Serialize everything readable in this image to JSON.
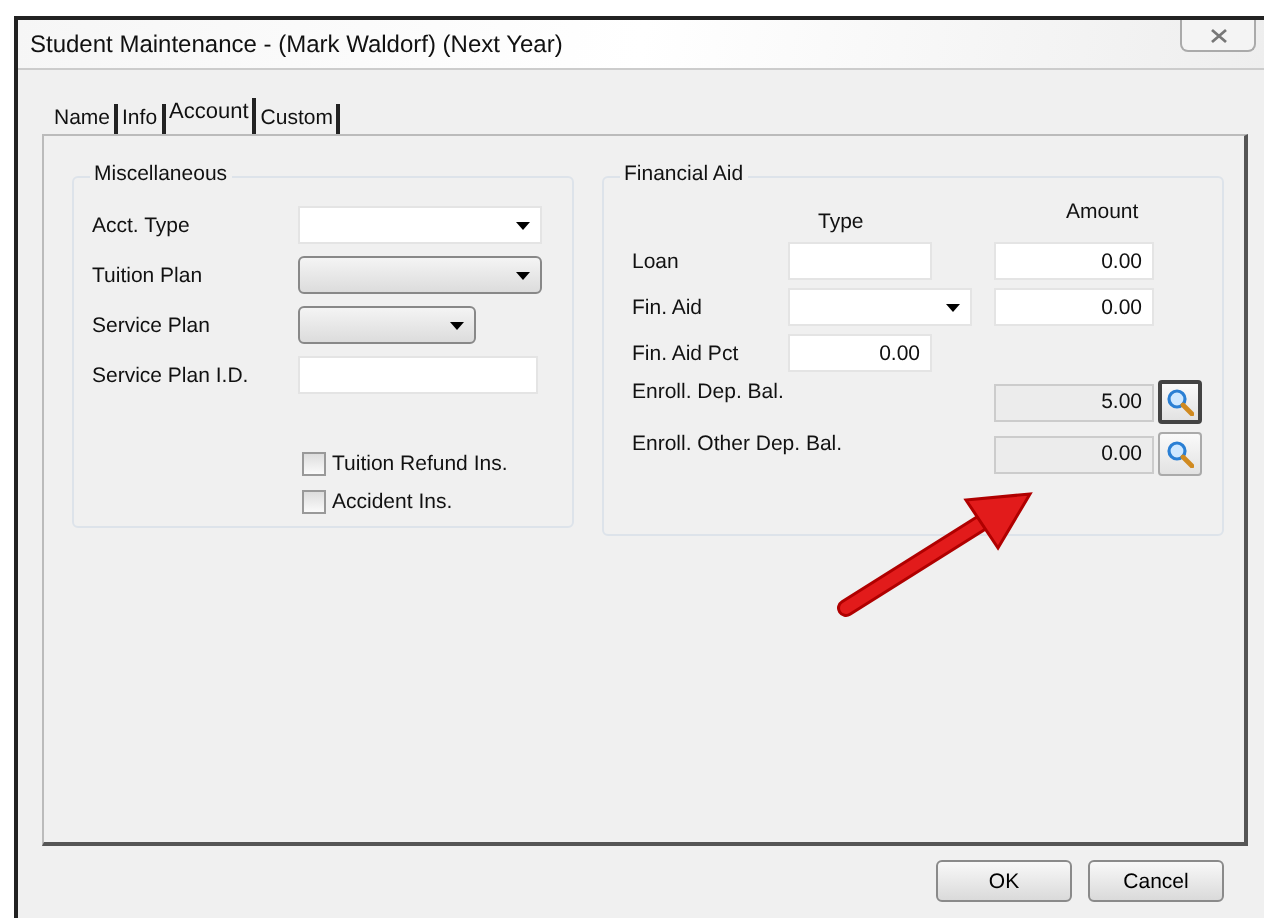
{
  "window": {
    "title": "Student Maintenance - (Mark Waldorf) (Next Year)"
  },
  "tabs": [
    {
      "label": "Name",
      "selected": false
    },
    {
      "label": "Info",
      "selected": false
    },
    {
      "label": "Account",
      "selected": true
    },
    {
      "label": "Custom",
      "selected": false
    }
  ],
  "miscellaneous": {
    "title": "Miscellaneous",
    "fields": [
      {
        "label": "Acct. Type",
        "kind": "dropdown"
      },
      {
        "label": "Tuition Plan",
        "kind": "combo"
      },
      {
        "label": "Service Plan",
        "kind": "combo"
      },
      {
        "label": "Service Plan I.D.",
        "kind": "text"
      }
    ],
    "checkboxes": [
      {
        "label": "Tuition Refund Ins.",
        "checked": false
      },
      {
        "label": "Accident Ins.",
        "checked": false
      }
    ]
  },
  "financial_aid": {
    "title": "Financial Aid",
    "columns": [
      "Type",
      "Amount"
    ],
    "rows": [
      {
        "label": "Loan",
        "kind": "text",
        "amount": "0.00"
      },
      {
        "label": "Fin. Aid",
        "kind": "dropdown",
        "amount": "0.00"
      },
      {
        "label": "Fin. Aid Pct",
        "kind": "percent",
        "type_value": "0.00"
      },
      {
        "label": "Enroll. Dep. Bal.",
        "kind": "lookup",
        "amount": "5.00",
        "focused": true
      },
      {
        "label": "Enroll. Other Dep. Bal.",
        "kind": "lookup",
        "amount": "0.00",
        "focused": false
      }
    ]
  },
  "buttons": [
    "OK",
    "Cancel"
  ]
}
